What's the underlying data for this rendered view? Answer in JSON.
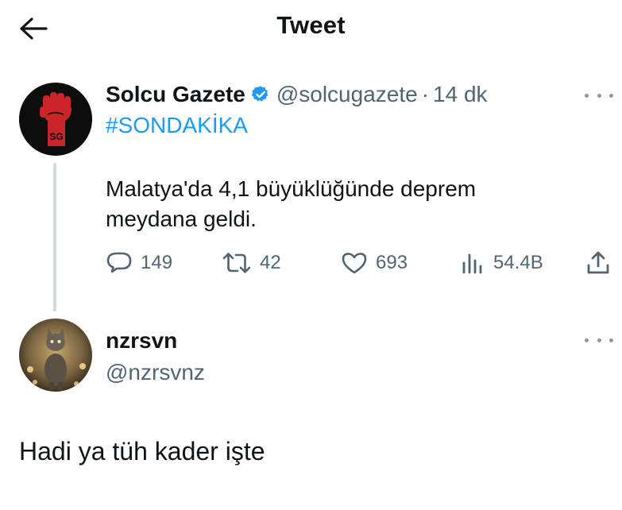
{
  "header": {
    "title": "Tweet",
    "back_icon": "arrow-left-icon"
  },
  "tweet": {
    "author_name": "Solcu Gazete",
    "author_handle": "@solcugazete",
    "separator": "·",
    "time": "14 dk",
    "hashtag": "#SONDAKİKA",
    "text": "Malatya'da 4,1 büyüklüğünde deprem meydana geldi.",
    "avatar_text": "SG",
    "stats": {
      "replies": "149",
      "retweets": "42",
      "likes": "693",
      "views": "54.4B"
    }
  },
  "reply": {
    "author_name": "nzrsvn",
    "author_handle": "@nzrsvnz",
    "text": "Hadi ya tüh kader işte"
  },
  "colors": {
    "accent": "#1d9bf0",
    "secondary_text": "#536471",
    "primary_text": "#0f1419",
    "thread_line": "#cfd9de"
  }
}
